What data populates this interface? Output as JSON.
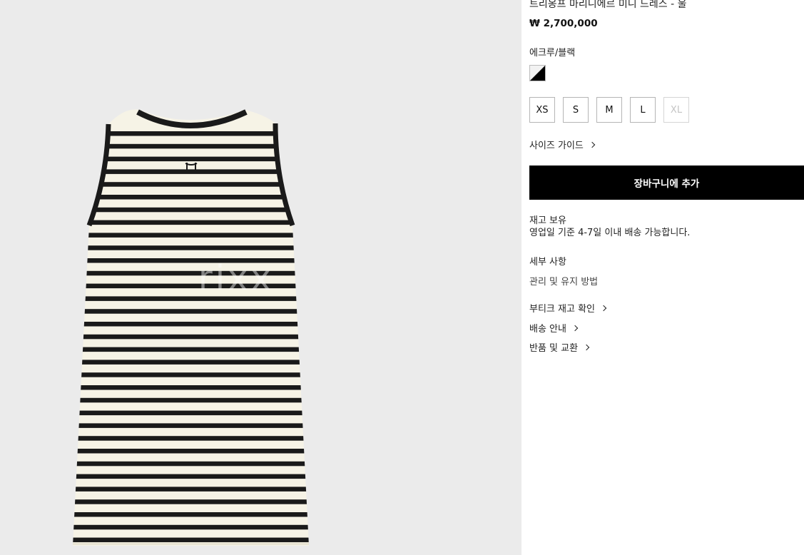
{
  "product": {
    "title": "트리옹프 마리니에르 미니 드레스 - 울",
    "price": "₩ 2,700,000",
    "color_name": "에크루/블랙",
    "sizes": [
      {
        "label": "XS",
        "available": true
      },
      {
        "label": "S",
        "available": true
      },
      {
        "label": "M",
        "available": true
      },
      {
        "label": "L",
        "available": true
      },
      {
        "label": "XL",
        "available": false
      }
    ],
    "size_guide": "사이즈 가이드",
    "add_to_cart": "장바구니에 추가",
    "stock_status": "재고 보유",
    "delivery_note": "영업일 기준 4-7일 이내 배송 가능합니다.",
    "details_heading": "세부 사항",
    "care_link": "관리 및 유지 방법",
    "links": {
      "boutique": "부티크 재고 확인",
      "shipping": "배송 안내",
      "returns": "반품 및 교환"
    }
  },
  "image": {
    "watermark": "rixx"
  },
  "colors": {
    "gallery_bg": "#ebebeb",
    "dress_ecru": "#f6f3e6",
    "stripe": "#1a1a1a",
    "button_bg": "#000000"
  }
}
